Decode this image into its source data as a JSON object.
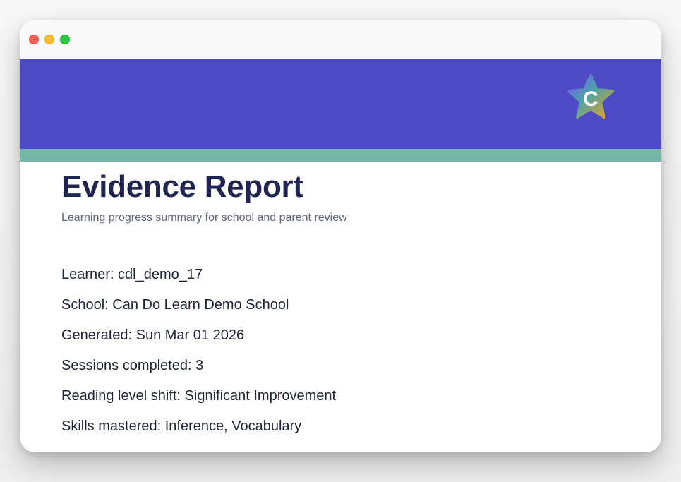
{
  "report": {
    "title": "Evidence Report",
    "subtitle": "Learning progress summary for school and parent review",
    "details": [
      "Learner: cdl_demo_17",
      "School: Can Do Learn Demo School",
      "Generated: Sun Mar 01 2026",
      "Sessions completed: 3",
      "Reading level shift: Significant Improvement",
      "Skills mastered: Inference, Vocabulary"
    ]
  },
  "branding": {
    "logo_icon": "star-logo-icon",
    "logo_letter": "C",
    "header_color": "#4E4AC4",
    "accent_color": "#74B7A7"
  }
}
